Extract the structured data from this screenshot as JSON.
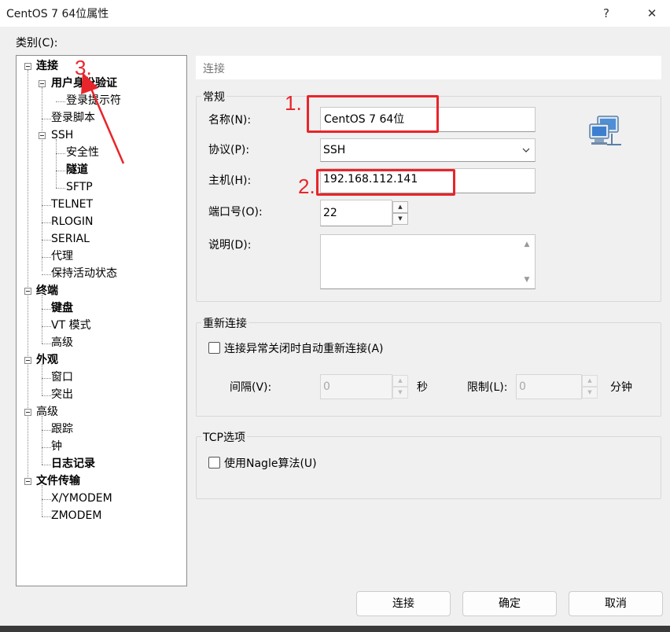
{
  "window": {
    "title": "CentOS 7 64位属性",
    "help_label": "?",
    "close_label": "✕"
  },
  "category_label": "类别(C):",
  "tree": {
    "connection": "连接",
    "user_auth": "用户身份验证",
    "login_prompt": "登录提示符",
    "login_script": "登录脚本",
    "ssh": "SSH",
    "security": "安全性",
    "tunnel": "隧道",
    "sftp": "SFTP",
    "telnet": "TELNET",
    "rlogin": "RLOGIN",
    "serial": "SERIAL",
    "proxy": "代理",
    "keepalive": "保持活动状态",
    "terminal": "终端",
    "keyboard": "键盘",
    "vt_mode": "VT 模式",
    "terminal_advanced": "高级",
    "appearance": "外观",
    "window": "窗口",
    "highlight": "突出",
    "advanced": "高级",
    "trace": "跟踪",
    "bell": "钟",
    "logging": "日志记录",
    "file_transfer": "文件传输",
    "xymodem": "X/YMODEM",
    "zmodem": "ZMODEM"
  },
  "header": "连接",
  "general": {
    "title": "常规",
    "name_label": "名称(N):",
    "name_value": "CentOS 7 64位",
    "protocol_label": "协议(P):",
    "protocol_value": "SSH",
    "host_label": "主机(H):",
    "host_value": "192.168.112.141",
    "port_label": "端口号(O):",
    "port_value": "22",
    "desc_label": "说明(D):",
    "desc_value": ""
  },
  "reconnect": {
    "title": "重新连接",
    "checkbox_label": "连接异常关闭时自动重新连接(A)",
    "interval_label": "间隔(V):",
    "interval_value": "0",
    "seconds_unit": "秒",
    "limit_label": "限制(L):",
    "limit_value": "0",
    "minutes_unit": "分钟"
  },
  "tcp": {
    "title": "TCP选项",
    "nagle_label": "使用Nagle算法(U)"
  },
  "buttons": {
    "connect": "连接",
    "ok": "确定",
    "cancel": "取消"
  },
  "annotations": {
    "one": "1.",
    "two": "2.",
    "three": "3."
  },
  "colors": {
    "annotation_red": "#e8252a",
    "window_bg": "#f0f0f0"
  }
}
